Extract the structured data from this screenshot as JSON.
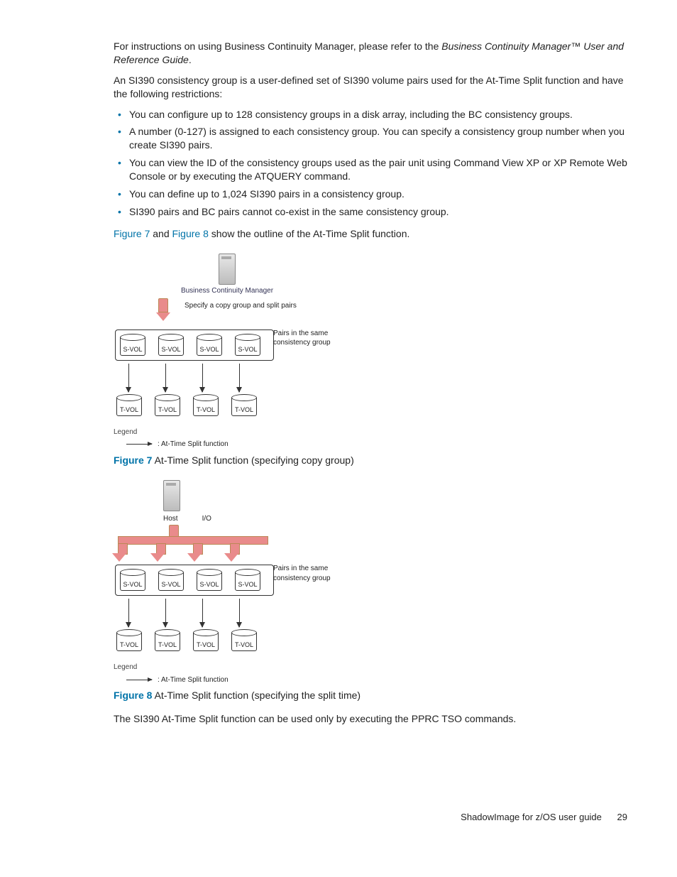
{
  "intro": {
    "p1_a": "For instructions on using Business Continuity Manager, please refer to the ",
    "p1_title": "Business Continuity Manager™ User and Reference Guide",
    "p1_b": ".",
    "p2": "An SI390 consistency group is a user-defined set of SI390 volume pairs used for the At-Time Split function and have the following restrictions:"
  },
  "bullets": [
    "You can configure up to 128 consistency groups in a disk array, including the BC consistency groups.",
    "A number (0-127) is assigned to each consistency group. You can specify a consistency group number when you create SI390 pairs.",
    "You can view the ID of the consistency groups used as the pair unit using Command View XP or XP Remote Web Console or by executing the ATQUERY command.",
    "You can define up to 1,024 SI390 pairs in a consistency group.",
    "SI390 pairs and BC pairs cannot co-exist in the same consistency group."
  ],
  "after_bullets": {
    "link1": "Figure 7",
    "mid": " and ",
    "link2": "Figure 8",
    "rest": " show the outline of the At-Time Split function."
  },
  "fig7": {
    "bcm": "Business Continuity Manager",
    "spec": "Specify a copy group and split pairs",
    "pairs_label": "Pairs in the same consistency group",
    "svol": "S-VOL",
    "tvol": "T-VOL",
    "legend_title": "Legend",
    "legend_item": ": At-Time Split function",
    "cap_num": "Figure 7",
    "cap_text": "  At-Time Split function (specifying copy group)"
  },
  "fig8": {
    "host": "Host",
    "io": "I/O",
    "pairs_label": "Pairs in the same consistency group",
    "svol": "S-VOL",
    "tvol": "T-VOL",
    "legend_title": "Legend",
    "legend_item": ": At-Time Split function",
    "cap_num": "Figure 8",
    "cap_text": "  At-Time Split function (specifying the split time)"
  },
  "closing": "The SI390 At-Time Split function can be used only by executing the PPRC TSO commands.",
  "footer": {
    "doc": "ShadowImage for z/OS user guide",
    "page": "29"
  }
}
